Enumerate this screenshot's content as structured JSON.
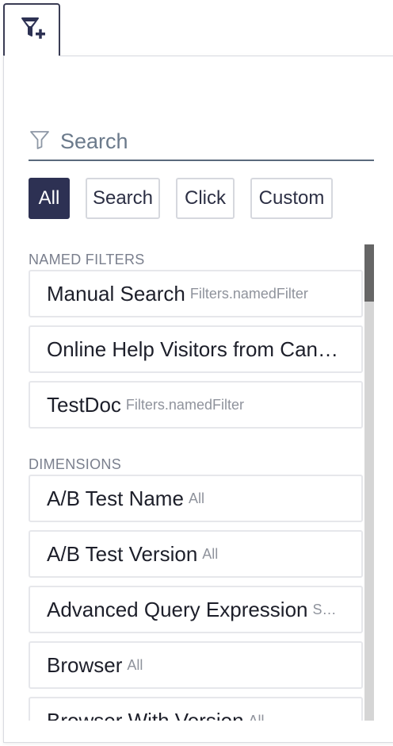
{
  "trigger": {
    "icon": "filter-add-icon"
  },
  "search": {
    "placeholder": "Search",
    "value": "",
    "icon": "filter-icon"
  },
  "chips": [
    {
      "label": "All",
      "active": true
    },
    {
      "label": "Search",
      "active": false
    },
    {
      "label": "Click",
      "active": false
    },
    {
      "label": "Custom",
      "active": false
    }
  ],
  "sections": {
    "named_filters": {
      "header": "NAMED FILTERS",
      "items": [
        {
          "name": "Manual Search",
          "sub": "Filters.namedFilter"
        },
        {
          "name": "Online Help Visitors from Can…",
          "sub": ""
        },
        {
          "name": "TestDoc",
          "sub": "Filters.namedFilter"
        }
      ]
    },
    "dimensions": {
      "header": "DIMENSIONS",
      "items": [
        {
          "name": "A/B Test Name",
          "sub": "All"
        },
        {
          "name": "A/B Test Version",
          "sub": "All"
        },
        {
          "name": "Advanced Query Expression",
          "sub": "S…"
        },
        {
          "name": "Browser",
          "sub": "All"
        },
        {
          "name": "Browser With Version",
          "sub": "All"
        }
      ]
    }
  },
  "colors": {
    "accent": "#2d3153",
    "border": "#e6e7eb",
    "muted": "#8f939c"
  }
}
